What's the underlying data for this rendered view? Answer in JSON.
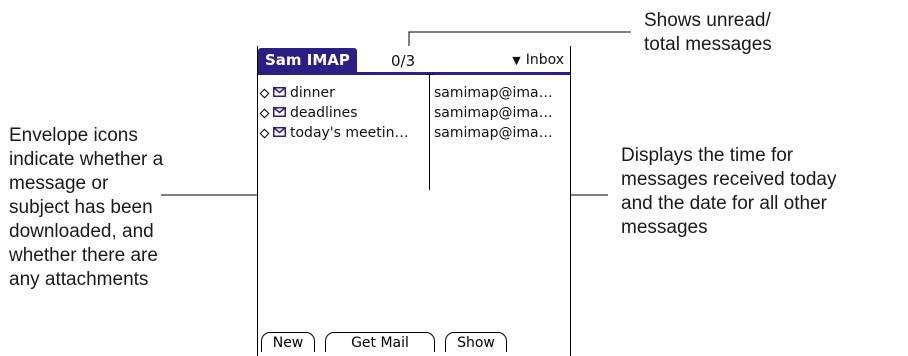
{
  "callouts": {
    "unread": [
      "Shows unread/",
      "total messages"
    ],
    "envelope": [
      "Envelope icons",
      "indicate whether a",
      "message or",
      "subject has been",
      "downloaded, and",
      "whether there are",
      "any attachments"
    ],
    "date": [
      "Displays the time for",
      "messages received today",
      "and the date for all other",
      "messages"
    ]
  },
  "app": {
    "title": "Sam IMAP",
    "count": "0/3",
    "folder": "Inbox"
  },
  "messages": [
    {
      "subject": "dinner",
      "sender": "samimap@ima…",
      "icon": "envelope-icon"
    },
    {
      "subject": "deadlines",
      "sender": "samimap@ima…",
      "icon": "envelope-icon"
    },
    {
      "subject": "today's meetin…",
      "sender": "samimap@ima…",
      "icon": "envelope-icon"
    }
  ],
  "buttons": {
    "new": "New",
    "get_mail": "Get Mail",
    "show": "Show"
  },
  "colors": {
    "title_bar": "#2b1f86"
  }
}
